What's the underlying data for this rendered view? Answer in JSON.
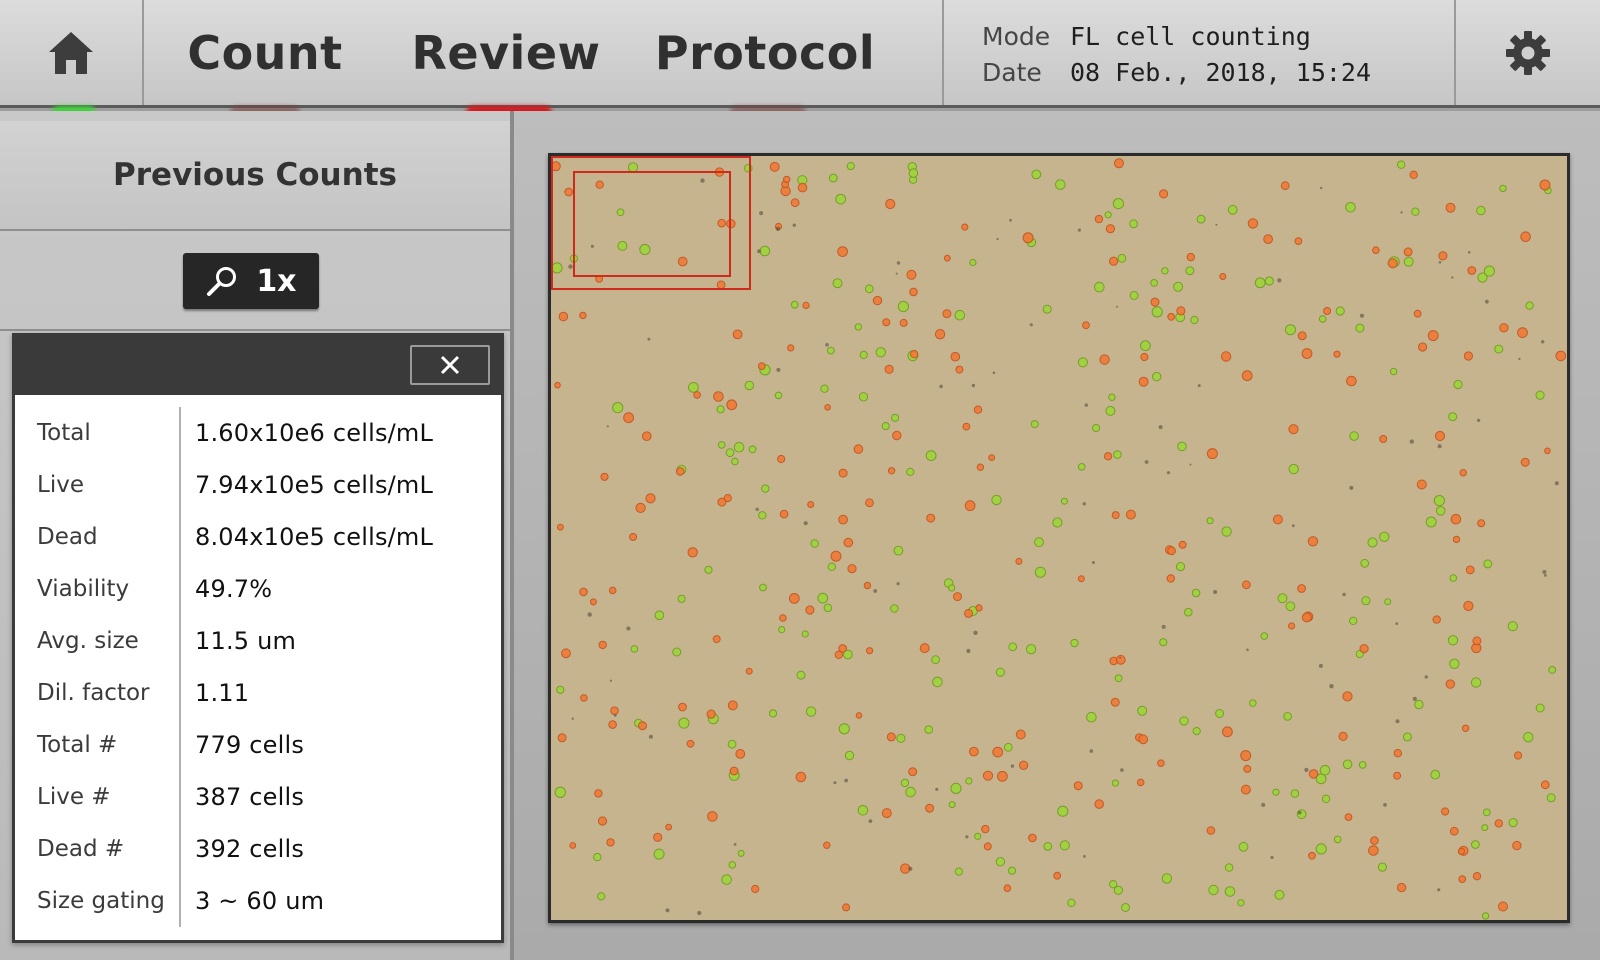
{
  "nav": {
    "home_icon": "home-icon",
    "tabs": [
      {
        "label": "Count"
      },
      {
        "label": "Review"
      },
      {
        "label": "Protocol"
      }
    ],
    "active_tab": "Review",
    "settings_icon": "gear-icon"
  },
  "status": {
    "mode_label": "Mode",
    "mode_value": "FL cell counting",
    "date_label": "Date",
    "date_value": "08 Feb., 2018, 15:24"
  },
  "left_panel": {
    "title": "Previous Counts",
    "zoom_icon": "magnifier-icon",
    "zoom_label": "1x",
    "close_icon": "close-icon",
    "results": [
      {
        "label": "Total",
        "value": "1.60x10e6 cells/mL"
      },
      {
        "label": "Live",
        "value": "7.94x10e5 cells/mL"
      },
      {
        "label": "Dead",
        "value": "8.04x10e5 cells/mL"
      },
      {
        "label": "Viability",
        "value": "49.7%"
      },
      {
        "label": "Avg. size",
        "value": "11.5 um"
      },
      {
        "label": "Dil. factor",
        "value": "1.11"
      },
      {
        "label": "Total #",
        "value": "779 cells"
      },
      {
        "label": "Live #",
        "value": "387 cells"
      },
      {
        "label": "Dead #",
        "value": "392 cells"
      },
      {
        "label": "Size gating",
        "value": "3 ~ 60 um"
      }
    ]
  },
  "colors": {
    "live_cell": "#9ed43a",
    "dead_cell": "#f07a36",
    "roi": "#d02a1c",
    "active_tab_indicator": "#d8161a",
    "status_led": "#3fd23a",
    "image_background": "#c6b48e"
  }
}
